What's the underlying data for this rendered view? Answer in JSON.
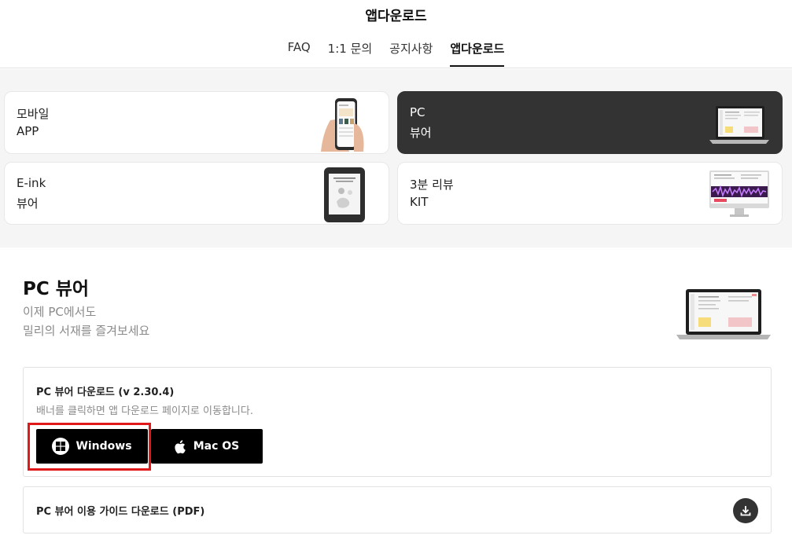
{
  "header": {
    "title": "앱다운로드",
    "tabs": [
      "FAQ",
      "1:1 문의",
      "공지사항",
      "앱다운로드"
    ],
    "active_tab": "앱다운로드"
  },
  "cards": [
    {
      "line1": "모바일",
      "line2": "APP",
      "image": "smartphone-in-hand"
    },
    {
      "line1": "PC",
      "line2": "뷰어",
      "image": "laptop",
      "selected": true
    },
    {
      "line1": "E-ink",
      "line2": "뷰어",
      "image": "e-reader"
    },
    {
      "line1": "3분 리뷰",
      "line2": "KIT",
      "image": "desktop-monitor"
    }
  ],
  "section": {
    "title": "PC 뷰어",
    "subtitle_line1": "이제 PC에서도",
    "subtitle_line2": "밀리의 서재를 즐겨보세요"
  },
  "download": {
    "title": "PC 뷰어 다운로드 (v 2.30.4)",
    "description": "배너를 클릭하면 앱 다운로드 페이지로 이동합니다.",
    "windows_label": "Windows",
    "mac_label": "Mac OS"
  },
  "guide": {
    "label": "PC 뷰어 이용 가이드 다운로드 (PDF)"
  },
  "colors": {
    "selected_card": "#333333",
    "button_bg": "#000000",
    "highlight_border": "#e0181a",
    "page_bg_gray": "#f5f5f5"
  }
}
